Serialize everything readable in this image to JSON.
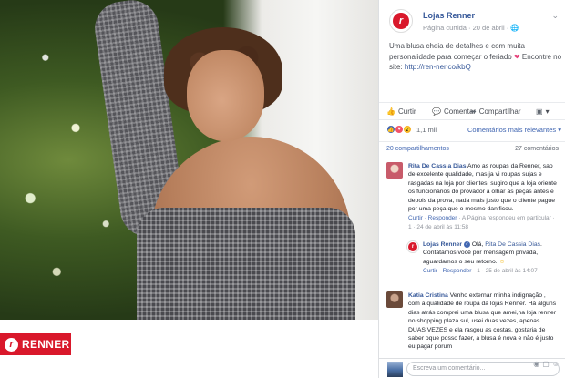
{
  "brand": {
    "logo_text": "RENNER",
    "logo_mark": "r",
    "color": "#d9182b"
  },
  "post": {
    "page_name": "Lojas Renner",
    "meta": "Página curtida · 20 de abril ·",
    "text": "Uma blusa cheia de detalhes e com muita personalidade para começar o feriado",
    "text_suffix": "Encontre no site:",
    "link": "http://ren-ner.co/kbQ"
  },
  "actions": {
    "like": "Curtir",
    "comment": "Comentar",
    "share": "Compartilhar"
  },
  "reactions": {
    "count": "1,1 mil",
    "order": "Comentários mais relevantes"
  },
  "stats": {
    "shares": "20 compartilhamentos",
    "comments": "27 comentários"
  },
  "comments": [
    {
      "name": "Rita De Cassia Dias",
      "text": "Amo as roupas da Renner, sao de excelente qualidade, mas ja vi roupas sujas e rasgadas na loja por clientes, sugiro que a loja oriente os funcionarios do provador a olhar as peças antes e depois da prova, nada mais justo que o cliente pague por uma peça que o mesmo danificou.",
      "meta_links": "Curtir · Responder",
      "meta": "· A Página respondeu em particular · 1 · 24 de abril às 11:58"
    },
    {
      "name": "Lojas Renner",
      "tag": "Rita De Cassia Dias",
      "text_pre": "Olá,",
      "text": ". Contatamos você por mensagem privada, aguardamos o seu retorno.",
      "meta_links": "Curtir · Responder",
      "meta": "· 1 · 25 de abril às 14:07"
    },
    {
      "name": "Katia Cristina",
      "text": "Venho externar minha indignação , com a qualidade de roupa da lojas Renner. Há alguns dias atrás comprei uma blusa que amei,na loja renner no shopping plaza sul, usei duas vezes, apenas DUAS VEZES e ela rasgou as costas, gostaria de saber oque posso fazer, a blusa é nova e não é justo eu pagar porum"
    }
  ],
  "write": {
    "placeholder": "Escreva um comentário..."
  }
}
